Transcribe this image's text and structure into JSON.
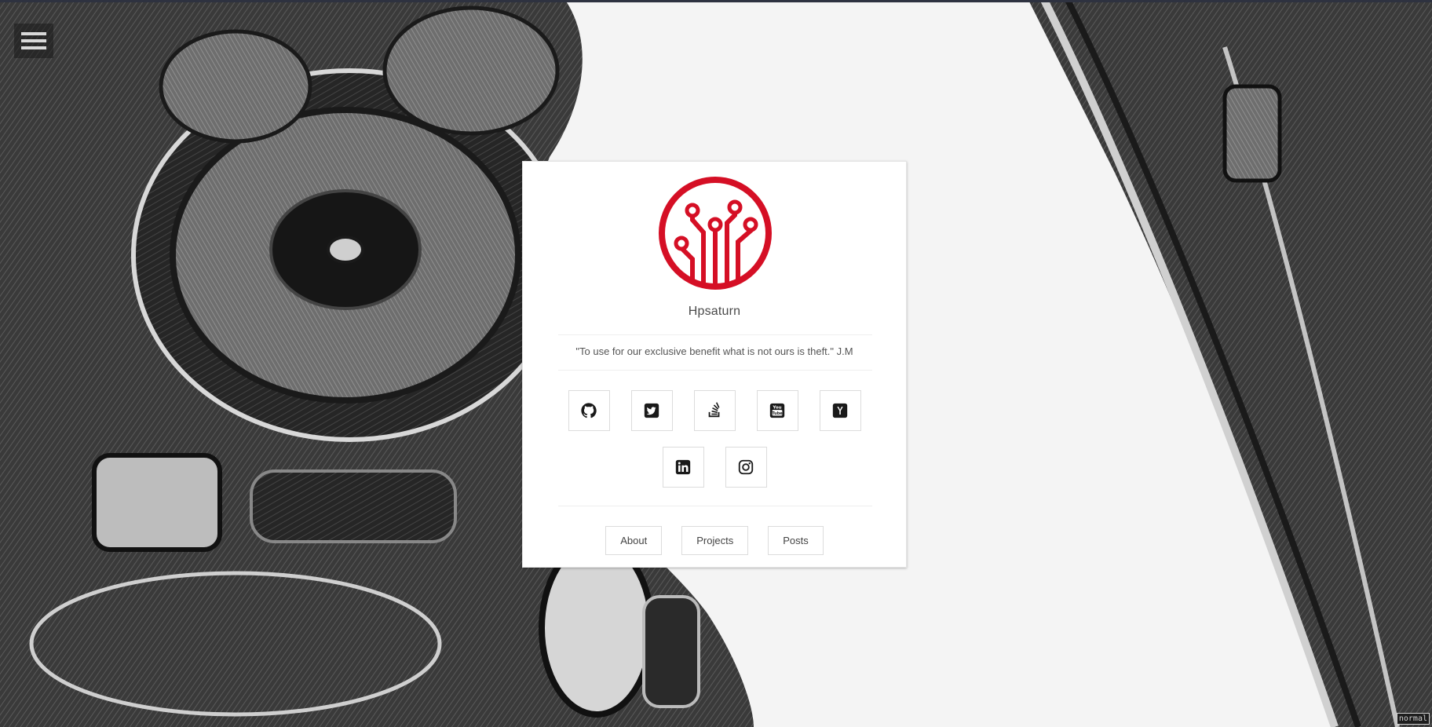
{
  "profile": {
    "name": "Hpsaturn",
    "quote": "\"To use for our exclusive benefit what is not ours is theft.\" J.M",
    "logo_icon": "circuit-logo-icon",
    "logo_color": "#d50f25"
  },
  "menu": {
    "icon": "hamburger-menu-icon"
  },
  "social": [
    {
      "icon": "github-icon"
    },
    {
      "icon": "twitter-icon"
    },
    {
      "icon": "stackoverflow-icon"
    },
    {
      "icon": "youtube-icon"
    },
    {
      "icon": "hackernews-icon"
    },
    {
      "icon": "linkedin-icon"
    },
    {
      "icon": "instagram-icon"
    }
  ],
  "nav": {
    "about": "About",
    "projects": "Projects",
    "posts": "Posts"
  },
  "status": {
    "mode": "normal"
  }
}
